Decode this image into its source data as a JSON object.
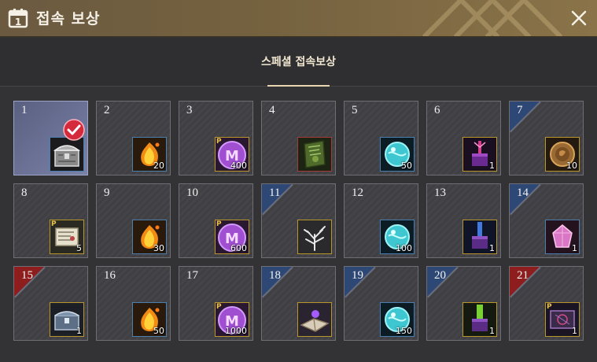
{
  "header": {
    "title": "접속 보상",
    "calendar_icon_digit": "1"
  },
  "tabs": [
    {
      "label": "스페셜 접속보상",
      "active": true
    }
  ],
  "colors": {
    "header": "#75623f",
    "claimed_cell": "#6d7498",
    "blue_corner": "#2e4876",
    "red_corner": "#8e1e1e",
    "gold_frame": "#b8962c"
  },
  "rewards": [
    {
      "day": "1",
      "icon": "treasure-chest-icon",
      "qty": "",
      "claimed": true,
      "corner": "none",
      "p": false,
      "frame": "blue"
    },
    {
      "day": "2",
      "icon": "fire-gem-icon",
      "qty": "20",
      "claimed": false,
      "corner": "none",
      "p": false,
      "frame": "blue"
    },
    {
      "day": "3",
      "icon": "mileage-coin-icon",
      "qty": "400",
      "claimed": false,
      "corner": "none",
      "p": true,
      "frame": "gold"
    },
    {
      "day": "4",
      "icon": "green-book-icon",
      "qty": "",
      "claimed": false,
      "corner": "none",
      "p": false,
      "frame": "red"
    },
    {
      "day": "5",
      "icon": "blue-orb-icon",
      "qty": "50",
      "claimed": false,
      "corner": "none",
      "p": false,
      "frame": "blue"
    },
    {
      "day": "6",
      "icon": "purple-box-icon",
      "qty": "1",
      "claimed": false,
      "corner": "none",
      "p": false,
      "frame": "gold"
    },
    {
      "day": "7",
      "icon": "bronze-coin-icon",
      "qty": "10",
      "claimed": false,
      "corner": "blue",
      "p": false,
      "frame": "gold"
    },
    {
      "day": "8",
      "icon": "scroll-map-icon",
      "qty": "5",
      "claimed": false,
      "corner": "none",
      "p": true,
      "frame": "gold"
    },
    {
      "day": "9",
      "icon": "fire-gem-icon",
      "qty": "30",
      "claimed": false,
      "corner": "none",
      "p": false,
      "frame": "blue"
    },
    {
      "day": "10",
      "icon": "mileage-coin-icon",
      "qty": "600",
      "claimed": false,
      "corner": "none",
      "p": true,
      "frame": "gold"
    },
    {
      "day": "11",
      "icon": "white-tree-icon",
      "qty": "",
      "claimed": false,
      "corner": "blue",
      "p": false,
      "frame": "gold"
    },
    {
      "day": "12",
      "icon": "blue-orb-icon",
      "qty": "100",
      "claimed": false,
      "corner": "none",
      "p": false,
      "frame": "blue"
    },
    {
      "day": "13",
      "icon": "blue-glow-box-icon",
      "qty": "1",
      "claimed": false,
      "corner": "none",
      "p": false,
      "frame": "gold"
    },
    {
      "day": "14",
      "icon": "pink-crystal-icon",
      "qty": "1",
      "claimed": false,
      "corner": "blue",
      "p": false,
      "frame": "blue"
    },
    {
      "day": "15",
      "icon": "silver-chest-icon",
      "qty": "1",
      "claimed": false,
      "corner": "red",
      "p": false,
      "frame": "gold"
    },
    {
      "day": "16",
      "icon": "fire-gem-icon",
      "qty": "50",
      "claimed": false,
      "corner": "none",
      "p": false,
      "frame": "blue"
    },
    {
      "day": "17",
      "icon": "mileage-coin-icon",
      "qty": "1000",
      "claimed": false,
      "corner": "none",
      "p": true,
      "frame": "gold"
    },
    {
      "day": "18",
      "icon": "purple-book-icon",
      "qty": "",
      "claimed": false,
      "corner": "blue",
      "p": false,
      "frame": "gold"
    },
    {
      "day": "19",
      "icon": "blue-orb-icon",
      "qty": "150",
      "claimed": false,
      "corner": "blue",
      "p": false,
      "frame": "blue"
    },
    {
      "day": "20",
      "icon": "green-glow-box-icon",
      "qty": "1",
      "claimed": false,
      "corner": "blue",
      "p": false,
      "frame": "gold"
    },
    {
      "day": "21",
      "icon": "dark-scroll-icon",
      "qty": "1",
      "claimed": false,
      "corner": "red",
      "p": true,
      "frame": "gold"
    }
  ]
}
